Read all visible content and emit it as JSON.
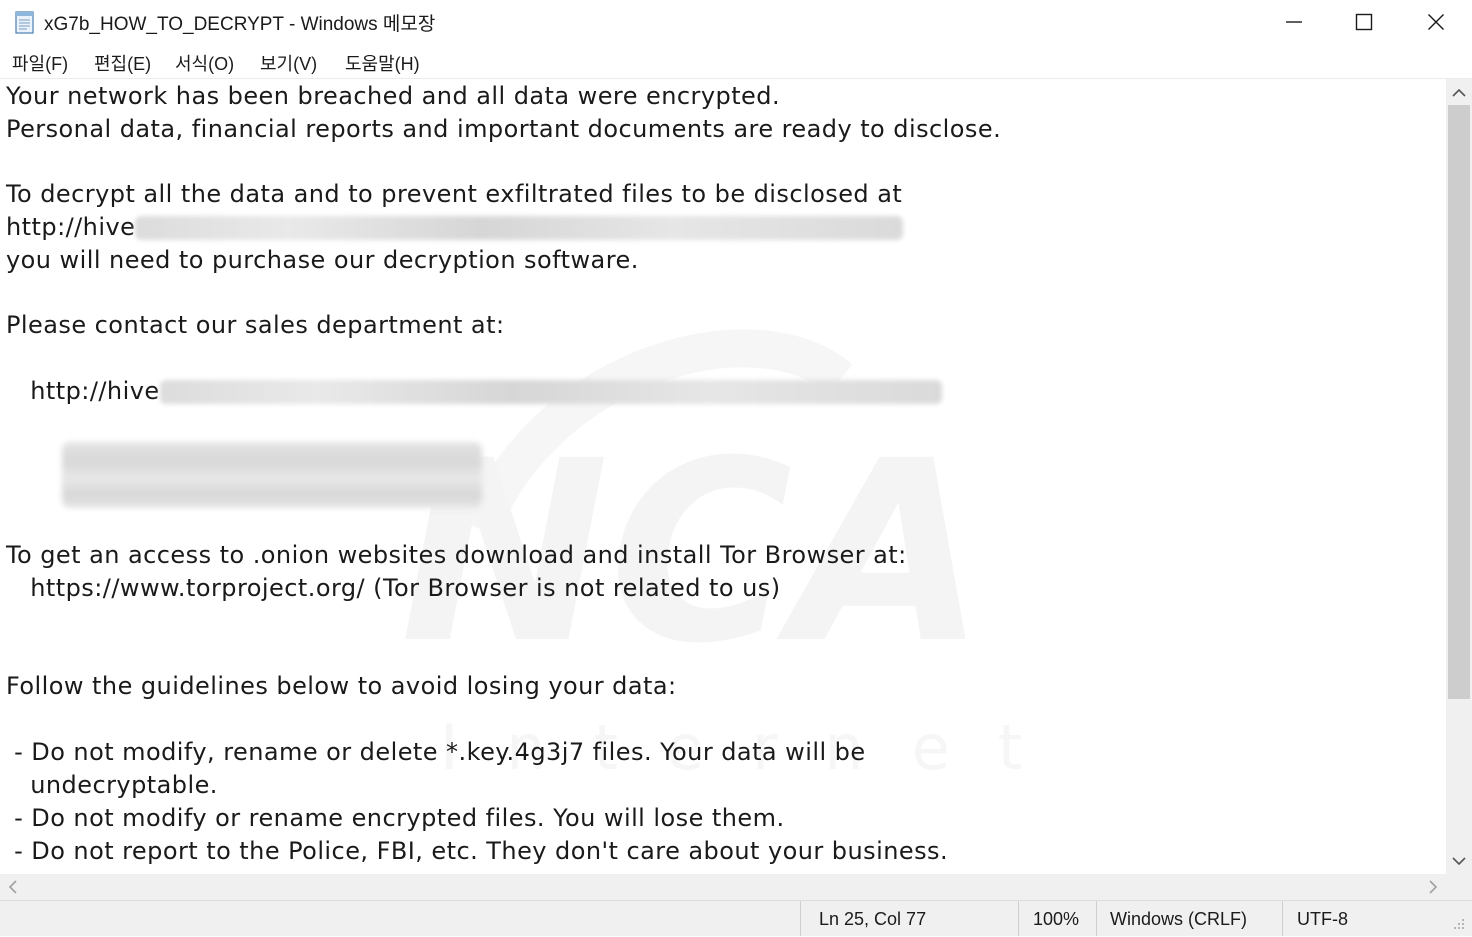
{
  "window": {
    "title": "xG7b_HOW_TO_DECRYPT - Windows 메모장",
    "controls": {
      "minimize": "minimize",
      "maximize": "maximize",
      "close": "close"
    }
  },
  "menu": {
    "file": "파일(F)",
    "edit": "편집(E)",
    "format": "서식(O)",
    "view": "보기(V)",
    "help": "도움말(H)"
  },
  "document": {
    "lines": {
      "l1": "Your network has been breached and all data were encrypted.",
      "l2": "Personal data, financial reports and important documents are ready to disclose.",
      "l3": "To decrypt all the data and to prevent exfiltrated files to be disclosed at",
      "l4": "http://hive",
      "l5": "you will need to purchase our decryption software.",
      "l6": "Please contact our sales department at:",
      "l7": "   http://hive",
      "l8": "To get an access to .onion websites download and install Tor Browser at:",
      "l9": "   https://www.torproject.org/ (Tor Browser is not related to us)",
      "l10": "Follow the guidelines below to avoid losing your data:",
      "l11": " - Do not modify, rename or delete *.key.4g3j7 files. Your data will be",
      "l12": "   undecryptable.",
      "l13": " - Do not modify or rename encrypted files. You will lose them.",
      "l14": " - Do not report to the Police, FBI, etc. They don't care about your business."
    },
    "watermark_text": "Internet",
    "watermark_logo": "NCA"
  },
  "status": {
    "position": "Ln 25, Col 77",
    "zoom": "100%",
    "line_ending": "Windows (CRLF)",
    "encoding": "UTF-8"
  },
  "icons": {
    "app": "notepad-icon",
    "scroll_up": "chevron-up-icon",
    "scroll_down": "chevron-down-icon",
    "scroll_left": "chevron-left-icon",
    "scroll_right": "chevron-right-icon"
  }
}
